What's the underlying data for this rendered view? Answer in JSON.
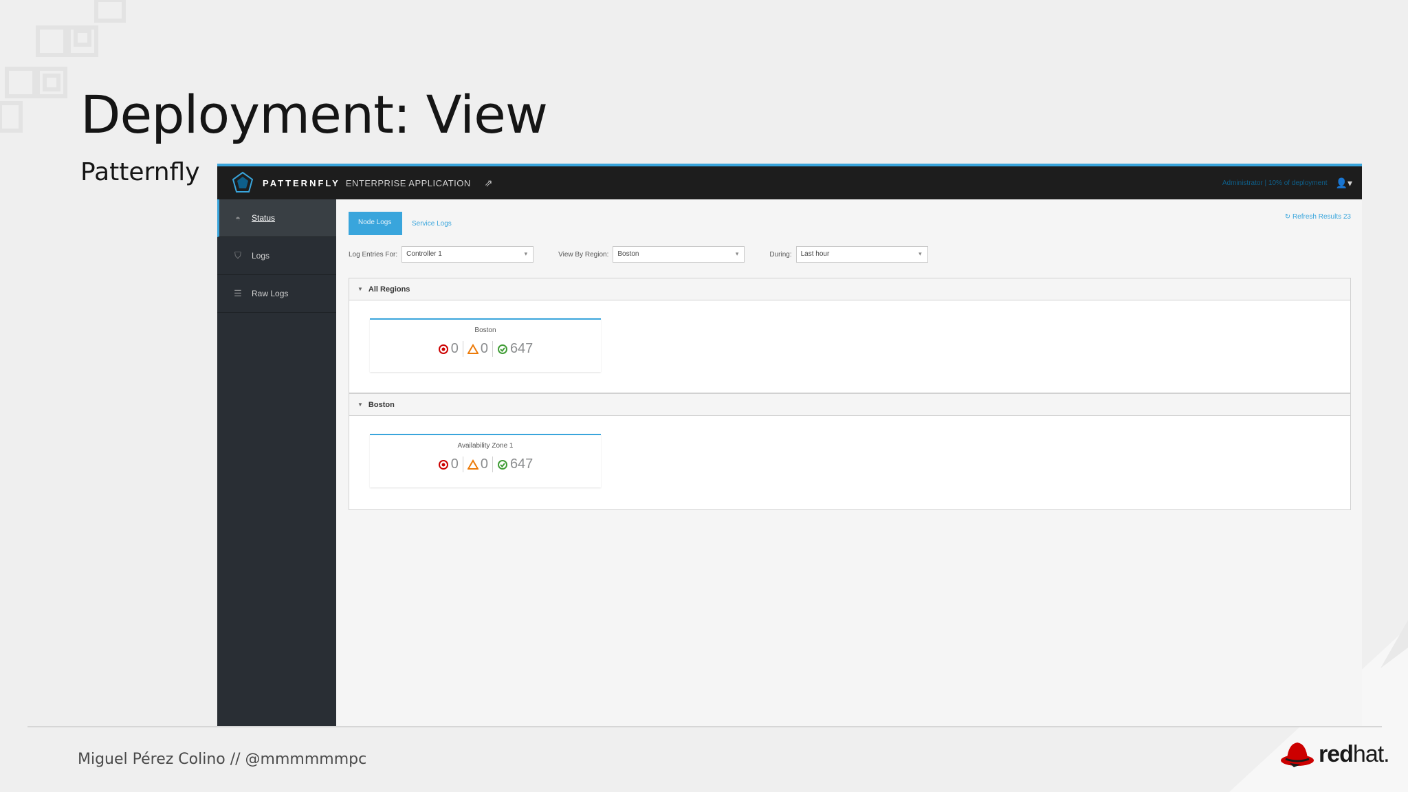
{
  "slide": {
    "title": "Deployment: View",
    "subtitle": "Patternfly",
    "footer": "Miguel Pérez Colino // @mmmmmmpc",
    "logo_text_bold": "red",
    "logo_text_light": "hat."
  },
  "app": {
    "brand_name": "PATTERNFLY",
    "brand_sub": "ENTERPRISE APPLICATION",
    "user_text": "Administrator | 10% of deployment",
    "sidebar": [
      {
        "label": "Status",
        "icon": "dashboard-icon",
        "active": true
      },
      {
        "label": "Logs",
        "icon": "shield-icon",
        "active": false
      },
      {
        "label": "Raw Logs",
        "icon": "database-icon",
        "active": false
      }
    ],
    "tabs": {
      "active": "Node Logs",
      "other": "Service Logs"
    },
    "refresh": "Refresh Results 23",
    "filters": [
      {
        "label": "Log Entries For:",
        "value": "Controller 1"
      },
      {
        "label": "View By Region:",
        "value": "Boston"
      },
      {
        "label": "During:",
        "value": "Last hour"
      }
    ],
    "panels": [
      {
        "heading": "All Regions",
        "card": {
          "title": "Boston",
          "errors": "0",
          "warnings": "0",
          "ok": "647"
        }
      },
      {
        "heading": "Boston",
        "card": {
          "title": "Availability Zone 1",
          "errors": "0",
          "warnings": "0",
          "ok": "647"
        }
      }
    ],
    "colors": {
      "accent": "#39a5dc",
      "navbar": "#1d1d1d",
      "sidebar": "#292e34",
      "error": "#cc0000",
      "warning": "#ec7a08",
      "ok": "#3f9c35"
    }
  }
}
